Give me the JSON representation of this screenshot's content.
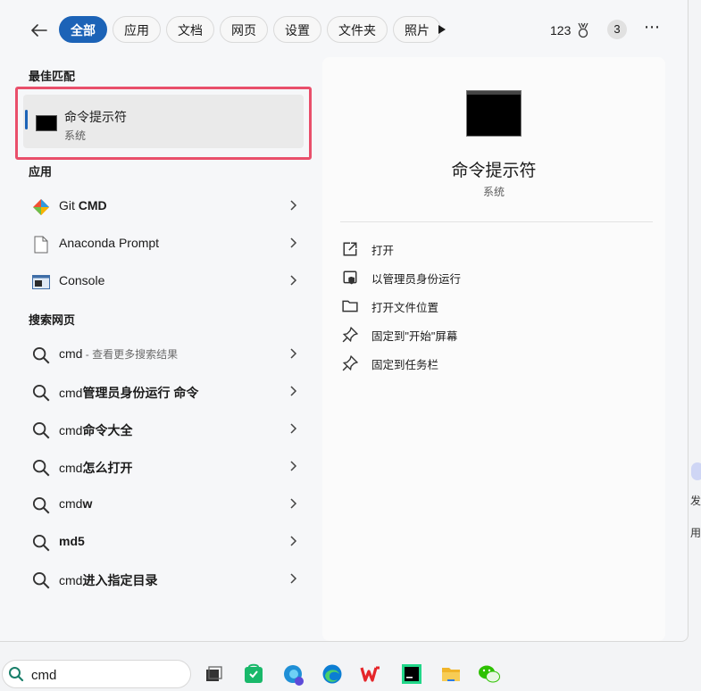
{
  "tabs": [
    "全部",
    "应用",
    "文档",
    "网页",
    "设置",
    "文件夹",
    "照片"
  ],
  "points": "123",
  "badge": "3",
  "sections": {
    "best": "最佳匹配",
    "apps": "应用",
    "web": "搜索网页"
  },
  "best_match": {
    "title": "命令提示符",
    "subtitle": "系统"
  },
  "apps": [
    {
      "pre": "Git ",
      "bold": "CMD",
      "icon": "git-icon"
    },
    {
      "pre": "Anaconda Prompt",
      "bold": "",
      "icon": "file-icon"
    },
    {
      "pre": "Console",
      "bold": "",
      "icon": "console-icon"
    }
  ],
  "web": [
    {
      "pre": "cmd",
      "bold": "",
      "suffix": " - 查看更多搜索结果"
    },
    {
      "pre": "cmd",
      "bold": "管理员身份运行 命令",
      "suffix": ""
    },
    {
      "pre": "cmd",
      "bold": "命令大全",
      "suffix": ""
    },
    {
      "pre": "cmd",
      "bold": "怎么打开",
      "suffix": ""
    },
    {
      "pre": "cmd",
      "bold": "w",
      "suffix": ""
    },
    {
      "pre": "",
      "bold": "md5",
      "suffix": ""
    },
    {
      "pre": "cmd",
      "bold": "进入指定目录",
      "suffix": ""
    }
  ],
  "detail": {
    "title": "命令提示符",
    "subtitle": "系统",
    "actions": [
      {
        "label": "打开",
        "icon": "open-external-icon"
      },
      {
        "label": "以管理员身份运行",
        "icon": "shield-icon"
      },
      {
        "label": "打开文件位置",
        "icon": "folder-icon"
      },
      {
        "label": "固定到\"开始\"屏幕",
        "icon": "pin-icon"
      },
      {
        "label": "固定到任务栏",
        "icon": "pin-icon"
      }
    ]
  },
  "search": {
    "value": "cmd"
  },
  "side_text": [
    "发",
    "用"
  ],
  "colors": {
    "accent": "#1c63b7",
    "highlight": "#e94f6b"
  }
}
